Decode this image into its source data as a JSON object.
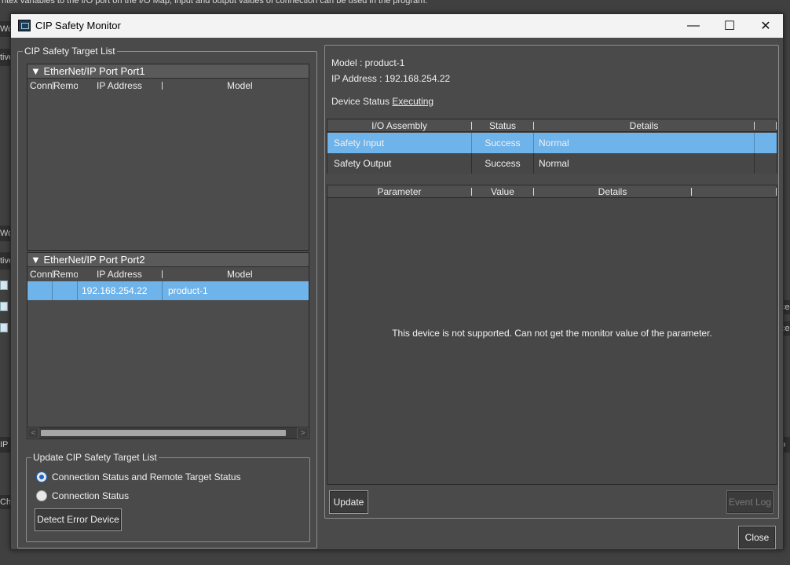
{
  "background": {
    "top_text": "ntex variables to the I/O port on the I/O Map, input and output values of connection can be used in the program.",
    "left_fragments": [
      "Wor",
      "tive",
      "Wor",
      "tive",
      "IP S",
      "Ch"
    ],
    "right_fragments": [
      "ce",
      "ce",
      "o"
    ]
  },
  "titlebar": {
    "title": "CIP Safety Monitor",
    "minimize": "—",
    "maximize": "☐",
    "close": "✕"
  },
  "target_list": {
    "label": "CIP Safety Target List",
    "columns": [
      "Conn",
      "Remo",
      "IP Address",
      "Model"
    ],
    "ports": [
      {
        "header": "▼ EtherNet/IP Port Port1",
        "rows": []
      },
      {
        "header": "▼ EtherNet/IP Port Port2",
        "rows": [
          {
            "conn": "",
            "remote": "",
            "ip": "192.168.254.22",
            "model": "product-1"
          }
        ]
      }
    ],
    "scroll_left": "<",
    "scroll_right": ">"
  },
  "update_group": {
    "label": "Update CIP Safety Target List",
    "options": [
      {
        "label": "Connection Status and Remote Target Status",
        "selected": true
      },
      {
        "label": "Connection Status",
        "selected": false
      }
    ],
    "detect_button": "Detect Error Device"
  },
  "device": {
    "model_label": "Model : product-1",
    "ip_label": "IP Address : 192.168.254.22",
    "status_label": "Device Status",
    "status_value": "Executing"
  },
  "assembly_table": {
    "columns": [
      "I/O Assembly",
      "Status",
      "Details"
    ],
    "rows": [
      {
        "assembly": "Safety Input",
        "status": "Success",
        "details": "Normal",
        "selected": true
      },
      {
        "assembly": "Safety Output",
        "status": "Success",
        "details": "Normal",
        "selected": false
      }
    ]
  },
  "parameter_table": {
    "columns": [
      "Parameter",
      "Value",
      "Details"
    ],
    "message": "This device is not supported. Can not get the monitor value of the parameter."
  },
  "buttons": {
    "update": "Update",
    "event_log": "Event Log",
    "close": "Close"
  },
  "colors": {
    "selection": "#6eb3ea",
    "dialog_bg": "#4a4a4a",
    "radio_accent": "#1e66c4"
  }
}
